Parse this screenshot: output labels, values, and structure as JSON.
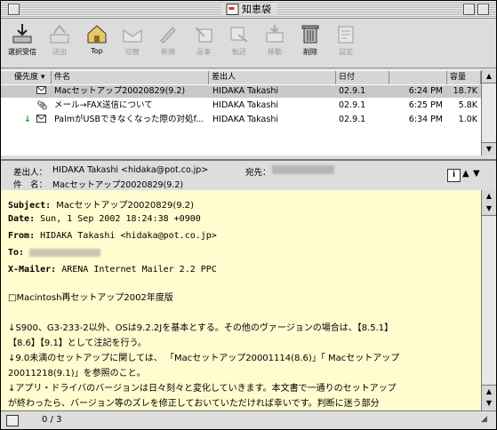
{
  "window": {
    "title": "知恵袋"
  },
  "toolbar": [
    {
      "label": "選択受信",
      "enabled": true,
      "icon": "download-tray-icon"
    },
    {
      "label": "送出",
      "enabled": false,
      "icon": "outbox-icon"
    },
    {
      "label": "Top",
      "enabled": true,
      "icon": "home-icon"
    },
    {
      "label": "切替",
      "enabled": false,
      "icon": "envelope-switch-icon"
    },
    {
      "label": "新規",
      "enabled": false,
      "icon": "pencil-icon"
    },
    {
      "label": "返事",
      "enabled": false,
      "icon": "reply-icon"
    },
    {
      "label": "転送",
      "enabled": false,
      "icon": "forward-icon"
    },
    {
      "label": "移動",
      "enabled": false,
      "icon": "move-icon"
    },
    {
      "label": "削除",
      "enabled": true,
      "icon": "trash-icon"
    },
    {
      "label": "設定",
      "enabled": false,
      "icon": "settings-icon"
    }
  ],
  "list_columns": [
    "優先度",
    "件名",
    "差出人",
    "日付",
    "",
    "容量"
  ],
  "messages": [
    {
      "icon": "envelope-icon",
      "flag": "",
      "subject": "Macセットアップ20020829(9.2)",
      "sender": "HIDAKA Takashi",
      "date": "02.9.1",
      "time": "6:24 PM",
      "size": "18.7K",
      "selected": true
    },
    {
      "icon": "paperclip-icon",
      "flag": "",
      "subject": "メール→FAX送信について",
      "sender": "HIDAKA Takashi",
      "date": "02.9.1",
      "time": "6:25 PM",
      "size": "5.8K",
      "selected": false
    },
    {
      "icon": "envelope-icon",
      "flag": "green-down-arrow",
      "subject": "PalmがUSBできなくなった際の対処f...",
      "sender": "HIDAKA Takashi",
      "date": "02.9.1",
      "time": "6:34 PM",
      "size": "1.0K",
      "selected": false
    }
  ],
  "header": {
    "from_label": "差出人：",
    "from_value": "HIDAKA Takashi <hidaka@pot.co.jp>",
    "to_label": "宛先：",
    "to_value": "",
    "subject_label": "件　名：",
    "subject_value": "Macセットアップ20020829(9.2)"
  },
  "body": {
    "subject_label": "Subject:",
    "subject_value": "Macセットアップ20020829(9.2)",
    "date_label": "Date:",
    "date_value": "Sun, 1 Sep 2002 18:24:38 +0900",
    "from_label": "From:",
    "from_value": "HIDAKA Takashi <hidaka@pot.co.jp>",
    "to_label": "To:",
    "mailer_label": "X-Mailer:",
    "mailer_value": "ARENA Internet Mailer 2.2 PPC",
    "lines": [
      "□Macintosh再セットアップ2002年度版",
      "↓S900、G3-233-2以外、OSは9.2.2Jを基本とする。その他のヴァージョンの場合は、【8.5.1】",
      "【8.6】【9.1】として注記を行う。",
      "↓9.0未満のセットアップに関しては、 「Macセットアップ20001114(8.6)」「 Macセットアップ",
      "20011218(9.1)」を参照のこと。",
      "↓アプリ・ドライバのバージョンは日々刻々と変化していきます。本文書で一通りのセットアップ",
      "が終わったら、バージョン等のズレを修正しておいていただければ幸いです。判断に迷う部分"
    ]
  },
  "status": {
    "count": "0 / 3"
  }
}
